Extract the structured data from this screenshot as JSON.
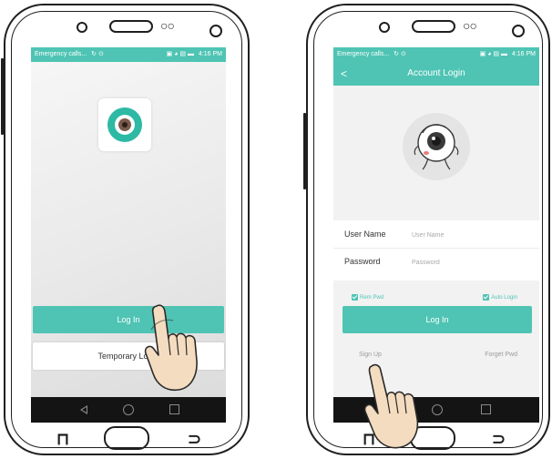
{
  "status_bar": {
    "left": {
      "carrier": "Emergency calls...",
      "icons": "↻ ⊙"
    },
    "right": {
      "icons": "▣ ◕ ▤ ▬",
      "time": "4:16 PM"
    }
  },
  "splash_screen": {
    "app_icon": "camera-lens-icon",
    "login_button": "Log In",
    "temporary_login_button": "Temporary Login"
  },
  "login_screen": {
    "title": "Account Login",
    "back_icon": "<",
    "avatar": "eyeball-mascot-icon",
    "username": {
      "label": "User Name",
      "placeholder": "User Name"
    },
    "password": {
      "label": "Password",
      "placeholder": "Password"
    },
    "remember_password": {
      "label": "Rem Pwd",
      "checked": true
    },
    "auto_login": {
      "label": "Auto Login",
      "checked": true
    },
    "login_button": "Log In",
    "sign_up_link": "Sign Up",
    "forgot_password_link": "Forget Pwd"
  },
  "hardware_keys": {
    "left": "⊓",
    "right": "⊃"
  },
  "colors": {
    "accent": "#4fc4b4",
    "nav_bar": "#141414",
    "frame": "#1f1f1f"
  }
}
